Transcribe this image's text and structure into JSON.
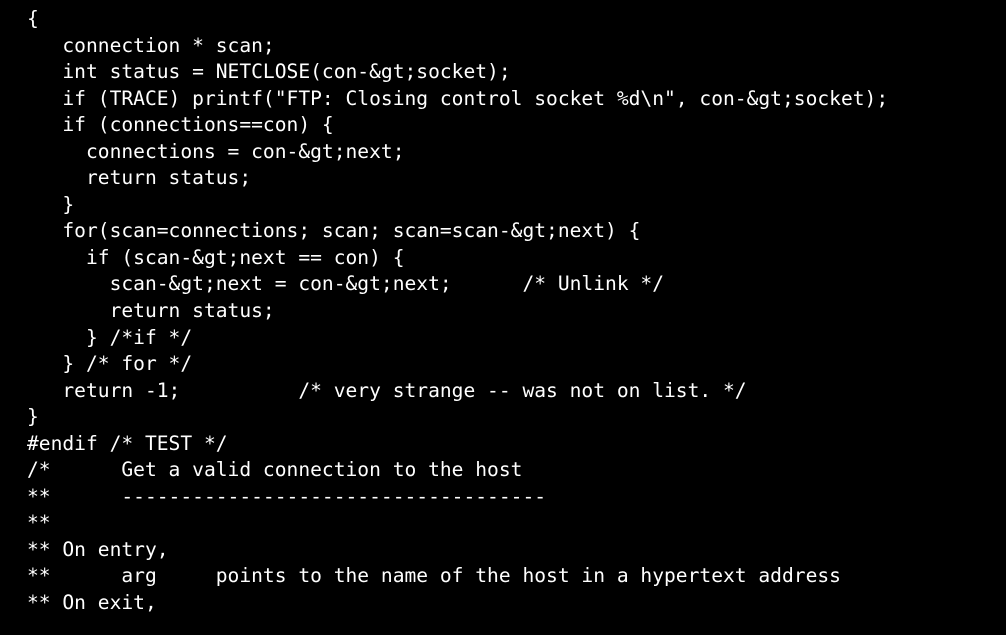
{
  "viewer": {
    "background_color": "#000000",
    "text_color": "#ffffff",
    "font_size_px": 19.6,
    "line_height_px": 26.55
  },
  "code": {
    "language": "c",
    "lines": [
      "{",
      "   connection * scan;",
      "   int status = NETCLOSE(con-&gt;socket);",
      "   if (TRACE) printf(\"FTP: Closing control socket %d\\n\", con-&gt;socket);",
      "   if (connections==con) {",
      "     connections = con-&gt;next;",
      "     return status;",
      "   }",
      "   for(scan=connections; scan; scan=scan-&gt;next) {",
      "     if (scan-&gt;next == con) {",
      "       scan-&gt;next = con-&gt;next;      /* Unlink */",
      "       return status;",
      "     } /*if */",
      "   } /* for */",
      "   return -1;          /* very strange -- was not on list. */",
      "}",
      "#endif /* TEST */",
      "/*      Get a valid connection to the host",
      "**      ------------------------------------",
      "**",
      "** On entry,",
      "**      arg     points to the name of the host in a hypertext address",
      "** On exit,"
    ]
  }
}
